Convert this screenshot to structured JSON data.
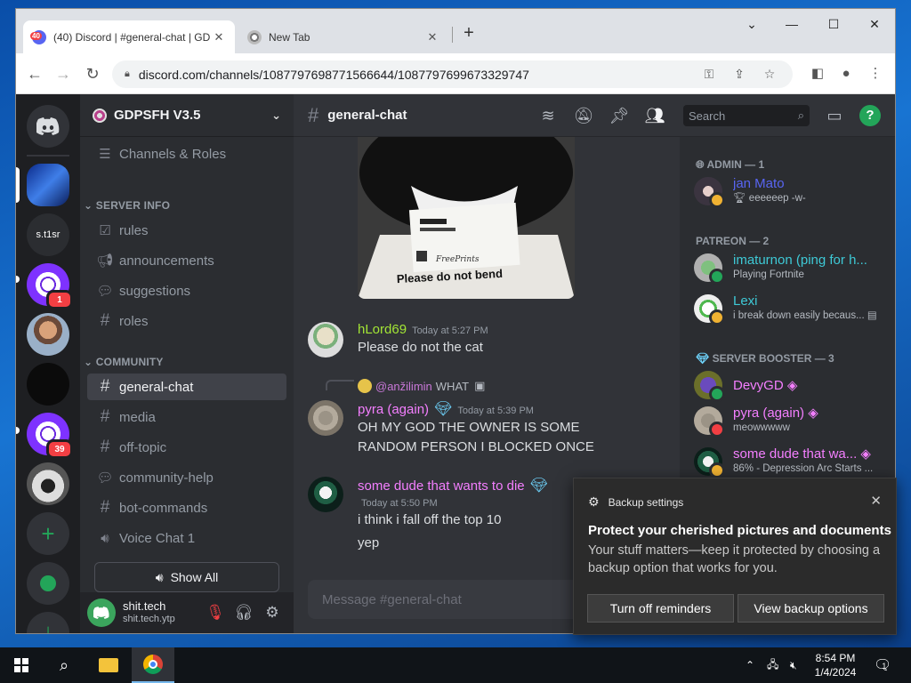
{
  "browser": {
    "tabs": [
      {
        "title": "(40) Discord | #general-chat | GD",
        "badge": "40",
        "active": true
      },
      {
        "title": "New Tab",
        "active": false
      }
    ],
    "new_tab": "+",
    "url": "discord.com/channels/1087797698771566644/1087797699673329747"
  },
  "discord": {
    "servers": [
      {
        "label": "",
        "type": "home"
      },
      {
        "label": "",
        "type": "selected"
      },
      {
        "label": "s.t1sr",
        "type": "text"
      },
      {
        "label": "",
        "badge": "1",
        "type": "film"
      },
      {
        "label": "",
        "type": "photo"
      },
      {
        "label": "",
        "type": "dark"
      },
      {
        "label": "",
        "badge": "39",
        "type": "film"
      },
      {
        "label": "",
        "type": "cat"
      },
      {
        "label": "+",
        "type": "add"
      },
      {
        "label": "",
        "type": "explore"
      }
    ],
    "guild_name": "GDPSFH V3.5",
    "channels_roles": "Channels & Roles",
    "categories": {
      "server_info": "SERVER INFO",
      "community": "COMMUNITY"
    },
    "channels": [
      {
        "name": "rules",
        "icon": "rules-icon"
      },
      {
        "name": "announcements",
        "icon": "megaphone-icon"
      },
      {
        "name": "suggestions",
        "icon": "forum-icon"
      },
      {
        "name": "roles",
        "icon": "hash-icon"
      },
      {
        "name": "general-chat",
        "icon": "hash-icon",
        "active": true
      },
      {
        "name": "media",
        "icon": "hash-icon"
      },
      {
        "name": "off-topic",
        "icon": "hash-icon"
      },
      {
        "name": "community-help",
        "icon": "forum-icon"
      },
      {
        "name": "bot-commands",
        "icon": "hash-icon"
      },
      {
        "name": "Voice Chat 1",
        "icon": "speaker-icon"
      }
    ],
    "show_all": "Show All",
    "user": {
      "name": "shit.tech",
      "tag": "shit.tech.ytp"
    },
    "header": {
      "channel": "general-chat",
      "search_placeholder": "Search"
    },
    "image_caption": "Please do not bend",
    "image_brand": "FreePrints",
    "messages": [
      {
        "author": "hLord69",
        "time": "Today at 5:27 PM",
        "lines": [
          "Please do not the cat"
        ],
        "color": "#a3e635"
      },
      {
        "reply_author": "@anžilimin",
        "reply_text": "WHAT",
        "author": "pyra (again)",
        "time": "Today at 5:39 PM",
        "lines": [
          "OH MY GOD THE OWNER IS SOME",
          "RANDOM PERSON I BLOCKED ONCE"
        ],
        "color": "#f47fff"
      },
      {
        "author": "some dude that wants to die",
        "time": "Today at 5:50 PM",
        "lines": [
          "i think i fall off the top 10",
          "yep"
        ],
        "color": "#f47fff"
      }
    ],
    "composer_placeholder": "Message #general-chat",
    "member_groups": [
      {
        "title": "ADMIN — 1",
        "members": [
          {
            "name": "jan Mato",
            "status": "eeeeeep -w-",
            "color": "#5865f2",
            "presence": "idle"
          }
        ]
      },
      {
        "title": "PATREON — 2",
        "members": [
          {
            "name": "imaturnon (ping for h...",
            "status": "Playing Fortnite",
            "color": "#3ec9d6",
            "presence": "online"
          },
          {
            "name": "Lexi",
            "status": "i break down easily becaus...",
            "color": "#3ec9d6",
            "presence": "idle"
          }
        ]
      },
      {
        "title": "SERVER BOOSTER — 3",
        "members": [
          {
            "name": "DevyGD",
            "status": "",
            "color": "#f47fff",
            "presence": "online"
          },
          {
            "name": "pyra (again)",
            "status": "meowwwww",
            "color": "#f47fff",
            "presence": "dnd"
          },
          {
            "name": "some dude that wa...",
            "status": "86% - Depression Arc Starts ...",
            "color": "#f47fff",
            "presence": "idle"
          }
        ]
      }
    ]
  },
  "toast": {
    "app": "Backup settings",
    "title": "Protect your cherished pictures and documents",
    "body": "Your stuff matters—keep it protected by choosing a backup option that works for you.",
    "btn_off": "Turn off reminders",
    "btn_view": "View backup options"
  },
  "taskbar": {
    "time": "8:54 PM",
    "date": "1/4/2024",
    "notif_count": "1"
  }
}
